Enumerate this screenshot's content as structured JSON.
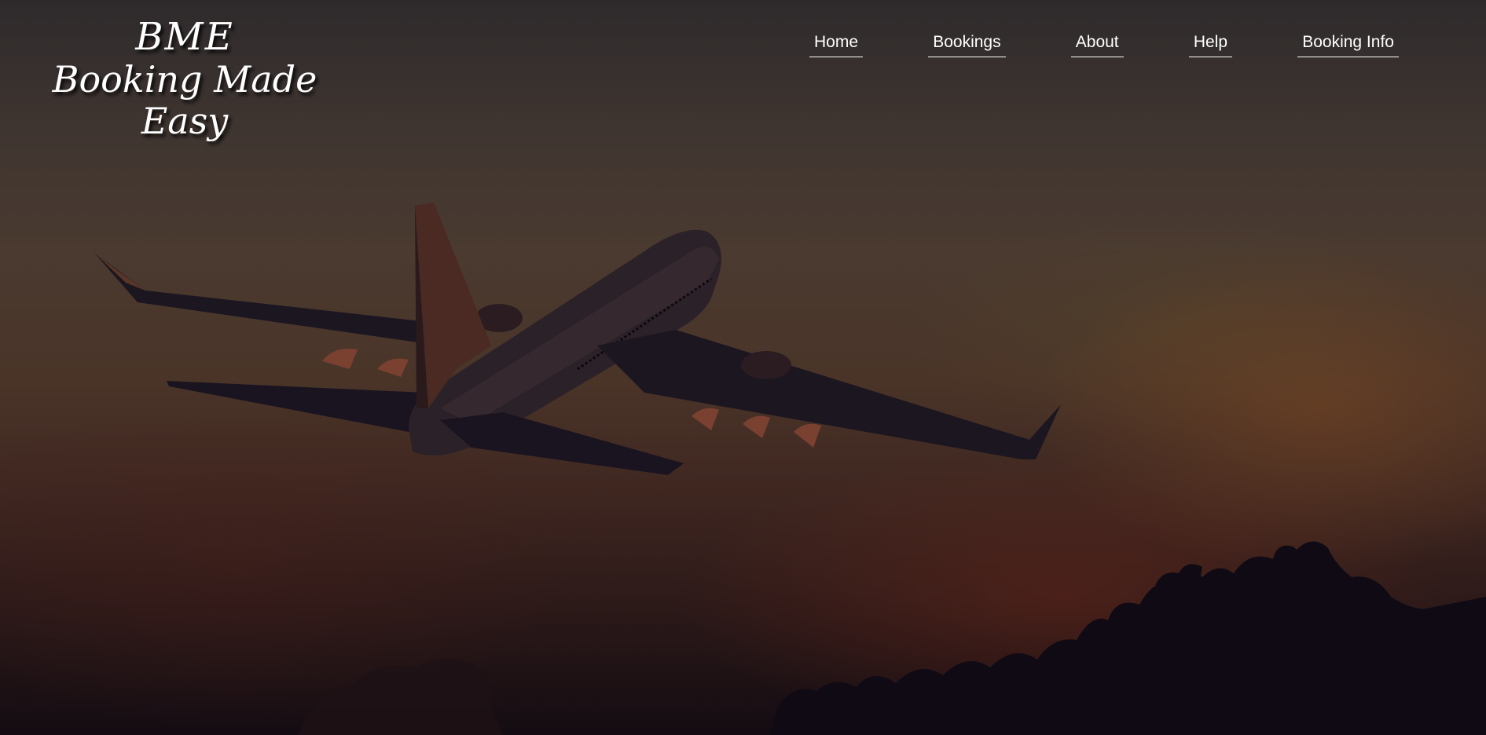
{
  "logo": {
    "line1": "BME",
    "line2": "Booking Made Easy"
  },
  "nav": {
    "items": [
      {
        "label": "Home"
      },
      {
        "label": "Bookings"
      },
      {
        "label": "About"
      },
      {
        "label": "Help"
      },
      {
        "label": "Booking Info"
      }
    ]
  },
  "colors": {
    "text": "#ffffff",
    "sky_top": "#2e2a2c",
    "sky_mid": "#4a3a30",
    "sky_bottom": "#130c12",
    "aircraft": "#1a1520"
  }
}
